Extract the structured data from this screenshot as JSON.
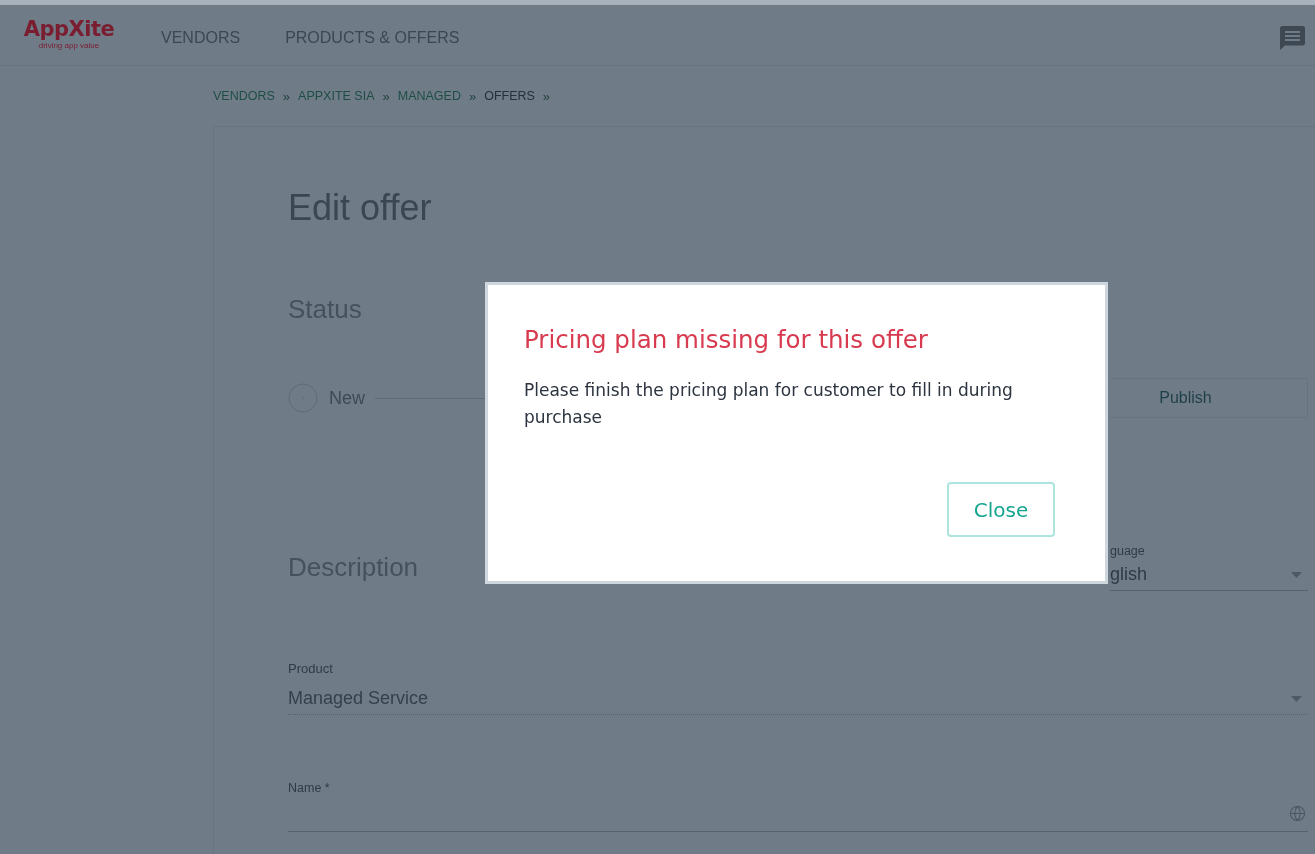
{
  "header": {
    "logo": {
      "name": "AppXite",
      "tagline": "driving app value"
    },
    "nav": [
      {
        "label": "VENDORS"
      },
      {
        "label": "PRODUCTS & OFFERS"
      }
    ]
  },
  "breadcrumb": [
    {
      "label": "VENDORS",
      "separator": "»",
      "current": false
    },
    {
      "label": "APPXITE SIA",
      "separator": "»",
      "current": false
    },
    {
      "label": "MANAGED",
      "separator": "»",
      "current": false
    },
    {
      "label": "OFFERS",
      "separator": "»",
      "current": true
    }
  ],
  "page": {
    "title": "Edit offer",
    "status": {
      "heading": "Status",
      "steps": [
        {
          "kind": "step",
          "label": "New"
        },
        {
          "kind": "button",
          "label": "Publish"
        }
      ]
    },
    "description": {
      "heading": "Description",
      "language": {
        "label": "guage",
        "value": "glish"
      },
      "product": {
        "label": "Product",
        "value": "Managed Service",
        "disabled": true
      },
      "name": {
        "label": "Name *"
      }
    }
  },
  "modal": {
    "title": "Pricing plan missing for this offer",
    "message": "Please finish the pricing plan for customer to fill in during purchase",
    "close_label": "Close"
  }
}
